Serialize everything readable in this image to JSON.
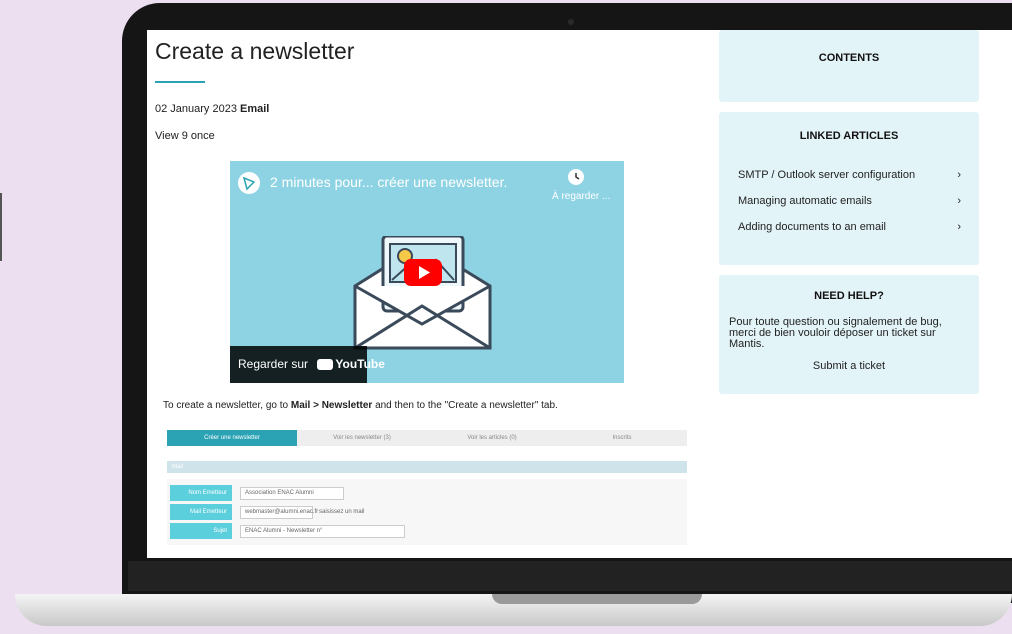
{
  "article": {
    "title": "Create a newsletter",
    "date": "02 January 2023",
    "category": "Email",
    "views": "View 9 once",
    "caption_before": "To create a newsletter, go to",
    "caption_path": "Mail > Newsletter",
    "caption_after": "and then to the \"Create a newsletter\" tab."
  },
  "video": {
    "title": "2 minutes pour... créer une newsletter.",
    "watch_later": "À regarder ...",
    "watch_on": "Regarder sur",
    "youtube": "YouTube"
  },
  "screenshot_form": {
    "tabs": [
      "Créer une newsletter",
      "Voir les newsletter (3)",
      "Voir les articles (0)",
      "Inscrits"
    ],
    "section": "Mail",
    "rows": [
      {
        "label": "Nom Emetteur",
        "value": "Association ENAC Alumni",
        "hint": ""
      },
      {
        "label": "Mail Emetteur",
        "value": "webmaster@alumni.enac.fr",
        "hint": "saisissez un mail"
      },
      {
        "label": "Sujet",
        "value": "ENAC Alumni - Newsletter n°",
        "hint": ""
      }
    ]
  },
  "sidebar": {
    "contents_title": "CONTENTS",
    "linked_title": "LINKED ARTICLES",
    "links": [
      {
        "label": "SMTP / Outlook server configuration"
      },
      {
        "label": "Managing automatic emails"
      },
      {
        "label": "Adding documents to an email"
      }
    ],
    "help_title": "NEED HELP?",
    "help_text": "Pour toute question ou signalement de bug, merci de bien vouloir déposer un ticket sur Mantis.",
    "submit_label": "Submit a ticket"
  },
  "colors": {
    "accent": "#2ba3b5",
    "sidebar_bg": "#e3f4f8",
    "video_bg": "#8ed3e3",
    "background": "#ece0f0"
  },
  "icons": {
    "link_chevron": "chevron-right-icon",
    "play": "play-icon",
    "clock": "clock-icon"
  }
}
